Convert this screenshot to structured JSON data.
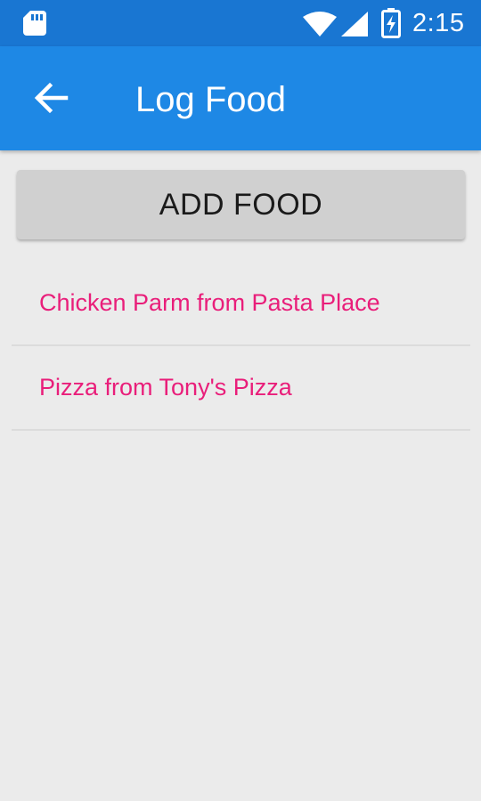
{
  "status_bar": {
    "time": "2:15",
    "icons": [
      "sd-card-icon",
      "wifi-icon",
      "signal-icon",
      "battery-charging-icon"
    ]
  },
  "app_bar": {
    "title": "Log Food",
    "back_icon": "arrow-back-icon",
    "background": "#1e88e5"
  },
  "main": {
    "add_button_label": "ADD FOOD",
    "foods": [
      {
        "label": "Chicken Parm from Pasta Place"
      },
      {
        "label": "Pizza from Tony's Pizza"
      }
    ]
  },
  "colors": {
    "accent_text": "#e91e7a",
    "status_bar": "#1976d2",
    "background": "#ebebeb"
  }
}
